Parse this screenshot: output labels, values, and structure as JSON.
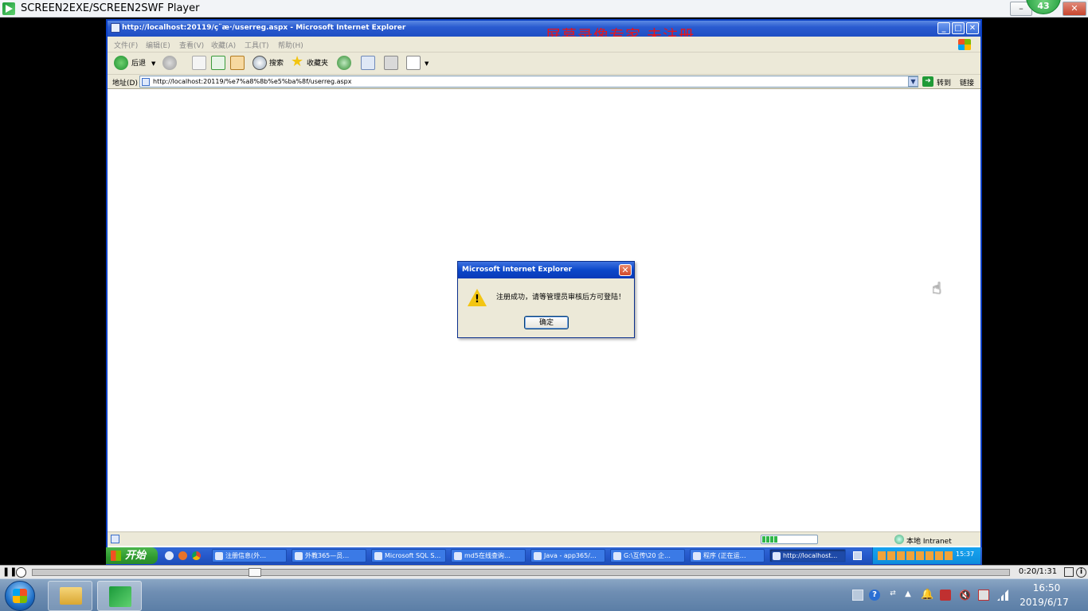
{
  "player": {
    "title": "SCREEN2EXE/SCREEN2SWF Player",
    "badge": "43",
    "time": "0:20/1:31"
  },
  "ie": {
    "title": "http://localhost:20119/ç¨æ·/userreg.aspx - Microsoft Internet Explorer",
    "watermark": "屏幕录像专家  未注册",
    "menu": [
      "文件(F)",
      "编辑(E)",
      "查看(V)",
      "收藏(A)",
      "工具(T)",
      "帮助(H)"
    ],
    "toolbar": {
      "back": "后退",
      "search": "搜索",
      "favorites": "收藏夹"
    },
    "address": {
      "label": "地址(D)",
      "url": "http://localhost:20119/%e7%a8%8b%e5%ba%8f/userreg.aspx",
      "go": "转到",
      "links": "链接"
    },
    "status": {
      "zone": "本地 Intranet",
      "progress": 0.3
    }
  },
  "dialog": {
    "title": "Microsoft Internet Explorer",
    "message": "注册成功，请等管理员审核后方可登陆！",
    "ok": "确定"
  },
  "xp_taskbar": {
    "start": "开始",
    "tasks": [
      "注册信息(外…",
      "外教365—员…",
      "Microsoft SQL S…",
      "md5在线查询…",
      "Java - app365/…",
      "G:\\互传\\20  企…",
      "程序 (正在运…",
      "http://localhost…"
    ],
    "clock": "15:37"
  },
  "w7_taskbar": {
    "time": "16:50",
    "date": "2019/6/17"
  }
}
